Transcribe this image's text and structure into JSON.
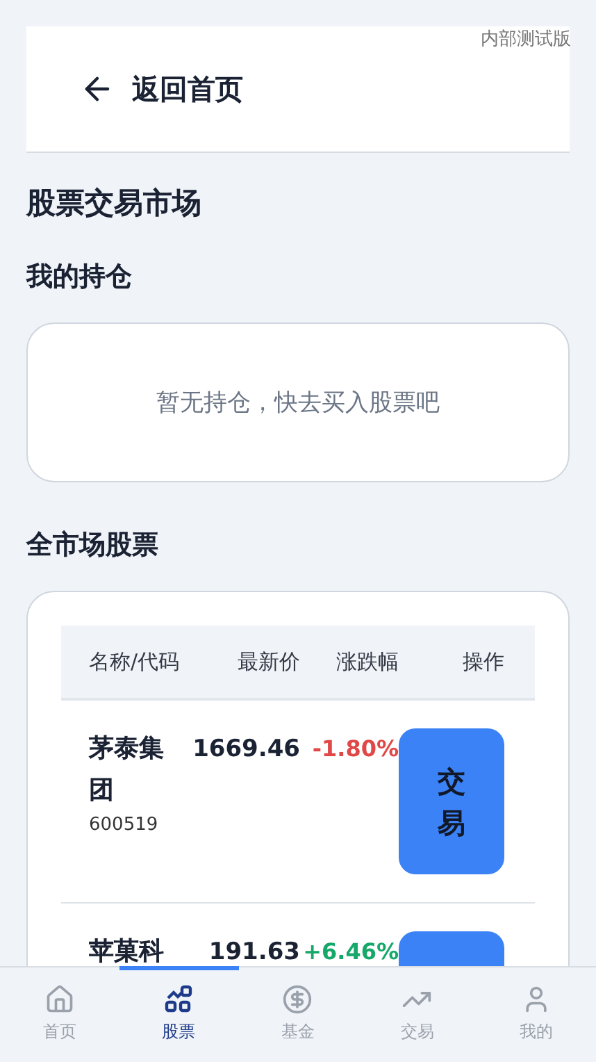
{
  "badge": "内部测试版",
  "header": {
    "back_label": "返回首页"
  },
  "page_title": "股票交易市场",
  "holdings": {
    "title": "我的持仓",
    "empty_text": "暂无持仓，快去买入股票吧"
  },
  "market": {
    "title": "全市场股票",
    "columns": [
      "名称/代码",
      "最新价",
      "涨跌幅",
      "操作"
    ],
    "rows": [
      {
        "name": "茅泰集团",
        "code": "600519",
        "price": "1669.46",
        "change": "-1.80%",
        "kind": "down",
        "action": "交易"
      },
      {
        "name": "苹菓科",
        "price": "191.63",
        "change": "+6.46%",
        "kind": "up"
      }
    ]
  },
  "tabs": [
    {
      "label": "首页",
      "kind": "home",
      "selected": false
    },
    {
      "label": "股票",
      "kind": "stocks",
      "selected": true
    },
    {
      "label": "基金",
      "kind": "fund",
      "selected": false
    },
    {
      "label": "交易",
      "kind": "trade",
      "selected": false
    },
    {
      "label": "我的",
      "kind": "user",
      "selected": false
    }
  ]
}
